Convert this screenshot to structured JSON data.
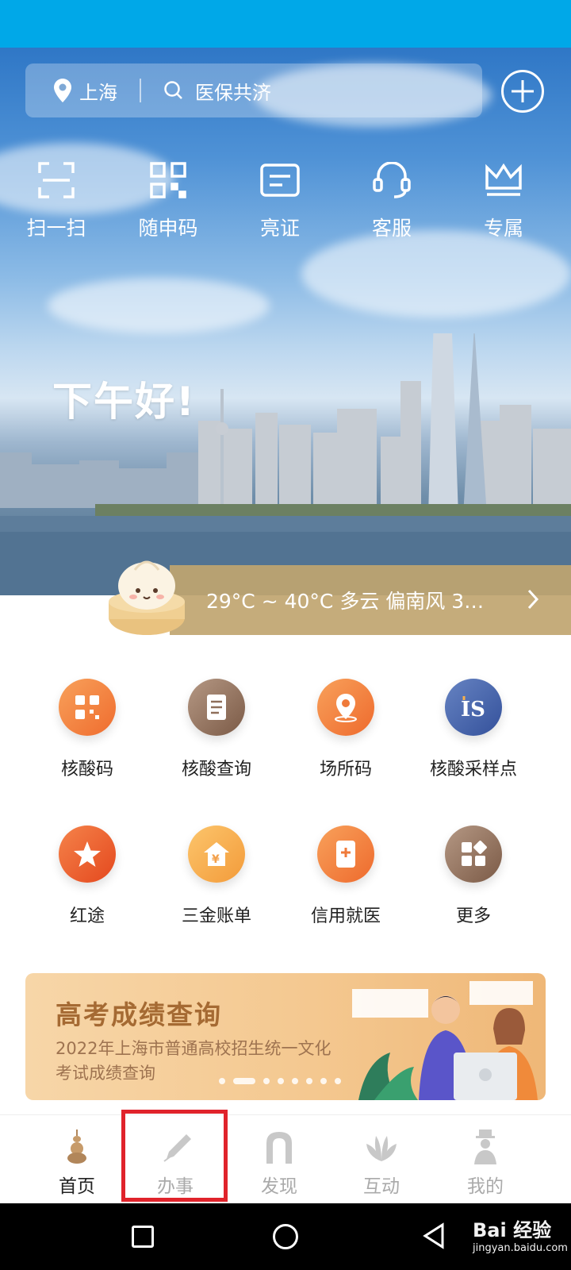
{
  "header": {
    "location": "上海",
    "search_text": "医保共济"
  },
  "quick_actions": [
    {
      "label": "扫一扫",
      "icon": "scan-icon"
    },
    {
      "label": "随申码",
      "icon": "qr-code-icon"
    },
    {
      "label": "亮证",
      "icon": "id-card-icon"
    },
    {
      "label": "客服",
      "icon": "headset-icon"
    },
    {
      "label": "专属",
      "icon": "crown-icon"
    }
  ],
  "greeting": "下午好!",
  "weather": {
    "text": "29°C ~ 40°C  多云  偏南风  3…"
  },
  "services": [
    {
      "label": "核酸码",
      "icon": "grid-qr-icon",
      "color": "#f27a3a"
    },
    {
      "label": "核酸查询",
      "icon": "document-icon",
      "color": "#8f6f5a"
    },
    {
      "label": "场所码",
      "icon": "location-pin-icon",
      "color": "#f2773a"
    },
    {
      "label": "核酸采样点",
      "icon": "is-logo-icon",
      "color": "#3e5fa6"
    },
    {
      "label": "红途",
      "icon": "star-icon",
      "color": "#ea5a2b"
    },
    {
      "label": "三金账单",
      "icon": "yuan-house-icon",
      "color": "#f6a94a"
    },
    {
      "label": "信用就医",
      "icon": "phone-medical-icon",
      "color": "#f27a3a"
    },
    {
      "label": "更多",
      "icon": "apps-icon",
      "color": "#8f6f5a"
    }
  ],
  "banner": {
    "title": "高考成绩查询",
    "subtitle": "2022年上海市普通高校招生统一文化考试成绩查询"
  },
  "tabs": [
    {
      "label": "首页",
      "icon": "pagoda-icon",
      "active": true
    },
    {
      "label": "办事",
      "icon": "pen-icon",
      "active": false
    },
    {
      "label": "发现",
      "icon": "arch-icon",
      "active": false
    },
    {
      "label": "互动",
      "icon": "magnolia-icon",
      "active": false
    },
    {
      "label": "我的",
      "icon": "person-icon",
      "active": false
    }
  ],
  "watermark": {
    "brand": "Bai 经验",
    "domain": "jingyan.baidu.com"
  }
}
